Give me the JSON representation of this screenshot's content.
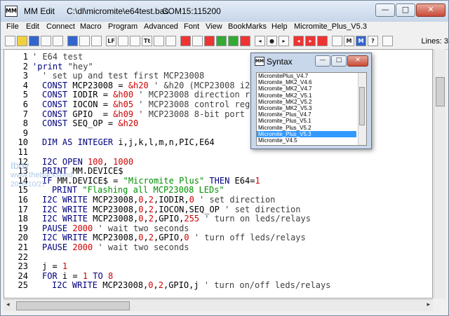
{
  "window": {
    "app_name": "MM Edit",
    "file_path": "C:\\dl\\micromite\\e64test.bas",
    "port": "COM15:115200",
    "buttons": {
      "minimize": "—",
      "maximize": "□",
      "close": "✕"
    }
  },
  "menu": [
    "File",
    "Edit",
    "Connect",
    "Macro",
    "Program",
    "Advanced",
    "Font",
    "View",
    "BookMarks",
    "Help",
    "Micromite_Plus_V5.3"
  ],
  "toolbar": {
    "icons": [
      "new-file-icon",
      "open-icon",
      "save-icon",
      "print-icon",
      "search-icon",
      "copy-icon",
      "paste-icon",
      "indent-icon",
      "lf-icon",
      "bookmark-icon",
      "tab-icon",
      "text-icon",
      "align-icon",
      "format-icon",
      "comment-icon",
      "delete-icon",
      "run-icon",
      "build-icon",
      "stop-icon",
      "tag-icon",
      "left-icon",
      "dot-icon",
      "right-icon",
      "prev-icon",
      "next-icon",
      "bug-icon",
      "mode-icon",
      "m-icon",
      "help-icon",
      "extra-icon"
    ],
    "lines_label": "Lines: 3"
  },
  "code": [
    {
      "n": "1",
      "t": [
        [
          "c",
          "' E64 test"
        ]
      ],
      "ind": 0
    },
    {
      "n": "2",
      "t": [
        [
          "k",
          "'print"
        ],
        [
          "c",
          " \"hey\""
        ]
      ],
      "ind": 0
    },
    {
      "n": "3",
      "t": [
        [
          "c",
          "' set up and test first MCP23008"
        ]
      ],
      "ind": 2
    },
    {
      "n": "4",
      "t": [
        [
          "k",
          "CONST"
        ],
        [
          "d",
          " MCP23008 = "
        ],
        [
          "n",
          "&h20"
        ],
        [
          "c",
          " ' &h20 (MCP23008 i2c"
        ]
      ],
      "ind": 2
    },
    {
      "n": "5",
      "t": [
        [
          "k",
          "CONST"
        ],
        [
          "d",
          " IODIR = "
        ],
        [
          "n",
          "&h00"
        ],
        [
          "c",
          " ' MCP23008 direction re"
        ]
      ],
      "ind": 2
    },
    {
      "n": "6",
      "t": [
        [
          "k",
          "CONST"
        ],
        [
          "d",
          " IOCON = "
        ],
        [
          "n",
          "&h05"
        ],
        [
          "c",
          " ' MCP23008 control regi"
        ]
      ],
      "ind": 2
    },
    {
      "n": "7",
      "t": [
        [
          "k",
          "CONST"
        ],
        [
          "d",
          " GPIO  = "
        ],
        [
          "n",
          "&h09"
        ],
        [
          "c",
          " ' MCP23008 8-bit port r"
        ]
      ],
      "ind": 2
    },
    {
      "n": "8",
      "t": [
        [
          "k",
          "CONST"
        ],
        [
          "d",
          " SEQ_OP = "
        ],
        [
          "n",
          "&h20"
        ]
      ],
      "ind": 2
    },
    {
      "n": "9",
      "t": [],
      "ind": 0
    },
    {
      "n": "10",
      "t": [
        [
          "k",
          "DIM AS INTEGER"
        ],
        [
          "d",
          " i,j,k,l,m,n,PIC,E64"
        ]
      ],
      "ind": 2
    },
    {
      "n": "11",
      "t": [],
      "ind": 0
    },
    {
      "n": "12",
      "t": [
        [
          "k",
          "I2C OPEN"
        ],
        [
          "n",
          " 100"
        ],
        [
          "d",
          ", "
        ],
        [
          "n",
          "1000"
        ]
      ],
      "ind": 2
    },
    {
      "n": "13",
      "t": [
        [
          "k",
          "PRINT"
        ],
        [
          "d",
          " MM.DEVICE$"
        ]
      ],
      "ind": 2
    },
    {
      "n": "14",
      "t": [
        [
          "k",
          "IF"
        ],
        [
          "d",
          " MM.DEVICE$ = "
        ],
        [
          "s",
          "\"Micromite Plus\""
        ],
        [
          "k",
          " THEN"
        ],
        [
          "d",
          " E64="
        ],
        [
          "n",
          "1"
        ]
      ],
      "ind": 2
    },
    {
      "n": "15",
      "t": [
        [
          "k",
          "PRINT"
        ],
        [
          "s",
          " \"Flashing all MCP23008 LEDs\""
        ]
      ],
      "ind": 4
    },
    {
      "n": "16",
      "t": [
        [
          "k",
          "I2C WRITE"
        ],
        [
          "d",
          " MCP23008,"
        ],
        [
          "n",
          "0"
        ],
        [
          "d",
          ","
        ],
        [
          "n",
          "2"
        ],
        [
          "d",
          ",IODIR,"
        ],
        [
          "n",
          "0"
        ],
        [
          "c",
          " ' set direction"
        ]
      ],
      "ind": 2
    },
    {
      "n": "17",
      "t": [
        [
          "k",
          "I2C WRITE"
        ],
        [
          "d",
          " MCP23008,"
        ],
        [
          "n",
          "0"
        ],
        [
          "d",
          ","
        ],
        [
          "n",
          "2"
        ],
        [
          "d",
          ",IOCON,SEQ_OP"
        ],
        [
          "c",
          " ' set direction"
        ]
      ],
      "ind": 2
    },
    {
      "n": "18",
      "t": [
        [
          "k",
          "I2C WRITE"
        ],
        [
          "d",
          " MCP23008,"
        ],
        [
          "n",
          "0"
        ],
        [
          "d",
          ","
        ],
        [
          "n",
          "2"
        ],
        [
          "d",
          ",GPIO,"
        ],
        [
          "n",
          "255"
        ],
        [
          "c",
          " ' turn on leds/relays"
        ]
      ],
      "ind": 2
    },
    {
      "n": "19",
      "t": [
        [
          "k",
          "PAUSE"
        ],
        [
          "n",
          " 2000"
        ],
        [
          "c",
          " ' wait two seconds"
        ]
      ],
      "ind": 2
    },
    {
      "n": "20",
      "t": [
        [
          "k",
          "I2C WRITE"
        ],
        [
          "d",
          " MCP23008,"
        ],
        [
          "n",
          "0"
        ],
        [
          "d",
          ","
        ],
        [
          "n",
          "2"
        ],
        [
          "d",
          ",GPIO,"
        ],
        [
          "n",
          "0"
        ],
        [
          "c",
          " ' turn off leds/relays"
        ]
      ],
      "ind": 2
    },
    {
      "n": "21",
      "t": [
        [
          "k",
          "PAUSE"
        ],
        [
          "n",
          " 2000"
        ],
        [
          "c",
          " ' wait two seconds"
        ]
      ],
      "ind": 2
    },
    {
      "n": "22",
      "t": [],
      "ind": 0
    },
    {
      "n": "23",
      "t": [
        [
          "d",
          "j = "
        ],
        [
          "n",
          "1"
        ]
      ],
      "ind": 2
    },
    {
      "n": "24",
      "t": [
        [
          "k",
          "FOR"
        ],
        [
          "d",
          " i = "
        ],
        [
          "n",
          "1"
        ],
        [
          "k",
          " TO"
        ],
        [
          "n",
          " 8"
        ]
      ],
      "ind": 2
    },
    {
      "n": "25",
      "t": [
        [
          "k",
          "I2C WRITE"
        ],
        [
          "d",
          " MCP23008,"
        ],
        [
          "n",
          "0"
        ],
        [
          "d",
          ","
        ],
        [
          "n",
          "2"
        ],
        [
          "d",
          ",GPIO,j"
        ],
        [
          "c",
          " ' turn on/off leds/relays"
        ]
      ],
      "ind": 4
    }
  ],
  "watermark": [
    "Ibby",
    "www.thebackshed",
    "2018/10/27"
  ],
  "syntax_dialog": {
    "title": "Syntax",
    "items": [
      "MicromitePlus_V4.7",
      "Micromite_MK2_V4.6",
      "Micromite_MK2_V4.7",
      "Micromite_MK2_V5.1",
      "Micromite_MK2_V5.2",
      "Micromite_MK2_V5.3",
      "Micromite_Plus_V4.7",
      "Micromite_Plus_V5.1",
      "Micromite_Plus_V5.2",
      "Micromite_Plus_V5.3",
      "Micromite_V4.5"
    ],
    "selected": 9
  }
}
